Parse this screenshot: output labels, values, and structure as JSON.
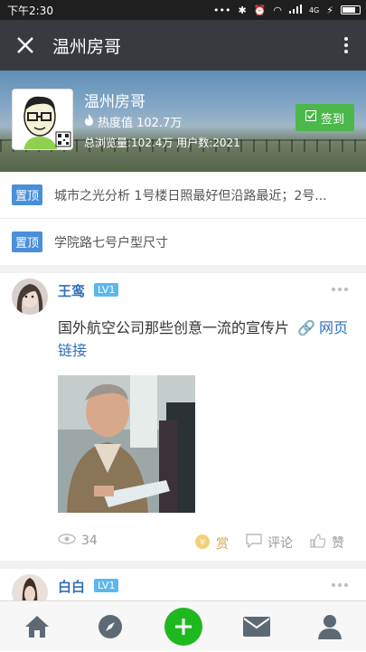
{
  "status_bar": {
    "time": "下午2:30",
    "network": "4G",
    "icons": [
      "dots-icon",
      "bluetooth-icon",
      "alarm-icon",
      "wifi-icon",
      "signal-icon",
      "charging-icon",
      "battery-icon"
    ]
  },
  "app_bar": {
    "title": "温州房哥",
    "close_icon": "close-icon",
    "more_icon": "more-vertical-icon"
  },
  "profile": {
    "name": "温州房哥",
    "heat_label": "热度值 102.7万",
    "stats": "总浏览量:102.4万 用户数:2021",
    "signin_label": "签到"
  },
  "pinned": [
    {
      "badge": "置顶",
      "text": "城市之光分析 1号楼日照最好但沿路最近；2号..."
    },
    {
      "badge": "置顶",
      "text": "学院路七号户型尺寸"
    }
  ],
  "posts": [
    {
      "user": "王鸾",
      "level": "LV1",
      "text": "国外航空公司那些创意一流的宣传片",
      "link_text": "网页链接",
      "views": "34",
      "reward_label": "赏",
      "comment_label": "评论",
      "like_label": "赞"
    },
    {
      "user": "白白",
      "level": "LV1"
    }
  ],
  "tab_bar": [
    "home-icon",
    "discover-compass-icon",
    "add-post-icon",
    "messages-icon",
    "profile-icon"
  ],
  "colors": {
    "app_bar": "#393a3f",
    "accent_green": "#4cb74b",
    "badge_blue": "#4a8fd9",
    "username_blue": "#2f6fb8",
    "level_blue": "#5bb8ee"
  }
}
